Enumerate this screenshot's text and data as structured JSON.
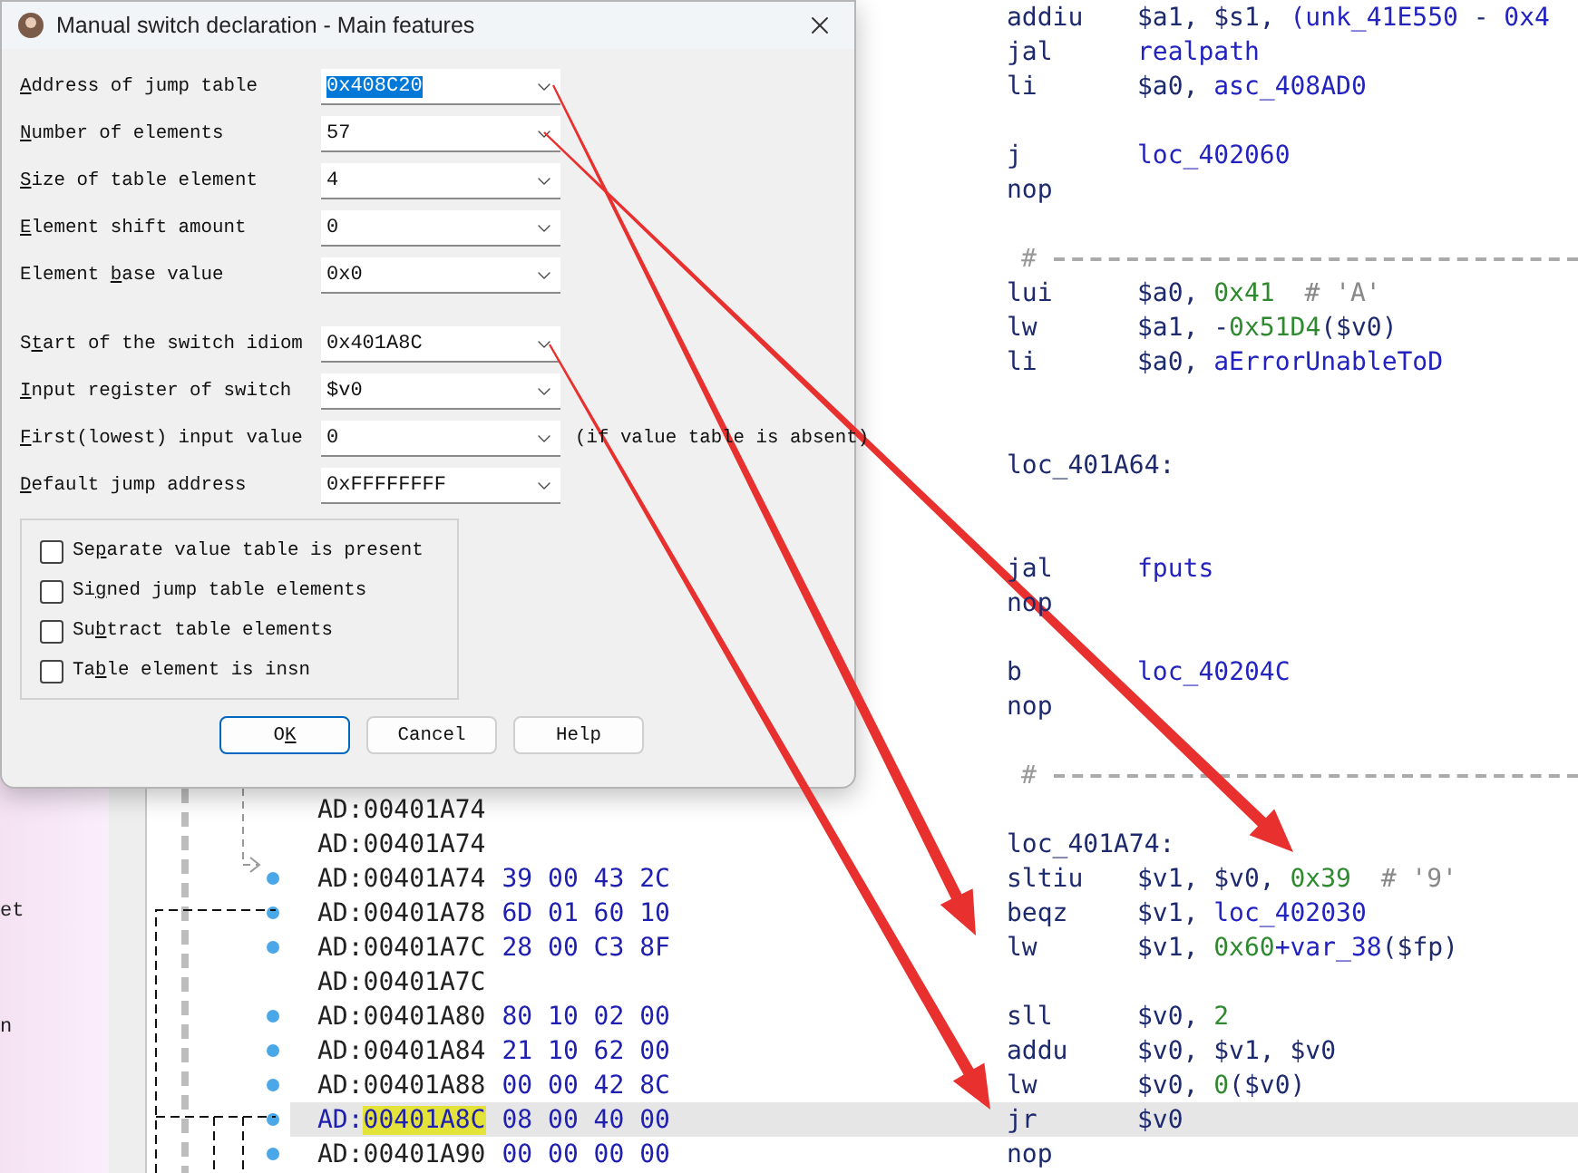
{
  "sidebar": {
    "fragments": [
      "et",
      "n"
    ]
  },
  "listing": {
    "rows": [
      {
        "kind": "insn",
        "highlighted": false,
        "mnemonic": "addiu",
        "operands": [
          [
            {
              "text": "$a1,",
              "kind": "reg"
            }
          ],
          [
            {
              "text": "$s1,",
              "kind": "reg"
            }
          ],
          [
            {
              "text": "(unk_41E550",
              "kind": "name"
            }
          ],
          [
            {
              "text": "-",
              "kind": "reg"
            }
          ],
          [
            {
              "text": "0x4",
              "kind": "name"
            }
          ]
        ]
      },
      {
        "kind": "insn",
        "highlighted": false,
        "mnemonic": "jal",
        "operands": [
          [
            {
              "text": "realpath",
              "kind": "name"
            }
          ]
        ]
      },
      {
        "kind": "insn",
        "highlighted": false,
        "mnemonic": "li",
        "operands": [
          [
            {
              "text": "$a0,",
              "kind": "reg"
            }
          ],
          [
            {
              "text": "asc_408AD0",
              "kind": "name"
            }
          ]
        ]
      },
      {
        "kind": "blank",
        "highlighted": false
      },
      {
        "kind": "insn",
        "highlighted": false,
        "mnemonic": "j",
        "operands": [
          [
            {
              "text": "loc_402060",
              "kind": "name"
            }
          ]
        ]
      },
      {
        "kind": "insn",
        "highlighted": false,
        "mnemonic": "nop"
      },
      {
        "kind": "blank",
        "highlighted": false
      },
      {
        "kind": "separator",
        "highlighted": false,
        "text": "#"
      },
      {
        "kind": "insn",
        "highlighted": false,
        "mnemonic": "lui",
        "operands": [
          [
            {
              "text": "$a0,",
              "kind": "reg"
            }
          ],
          [
            {
              "text": "0x41",
              "kind": "num"
            }
          ]
        ],
        "comment": "# 'A'"
      },
      {
        "kind": "insn",
        "highlighted": false,
        "mnemonic": "lw",
        "operands": [
          [
            {
              "text": "$a1,",
              "kind": "reg"
            }
          ],
          [
            {
              "text": "-",
              "kind": "reg"
            },
            {
              "text": "0x51D4",
              "kind": "num"
            },
            {
              "text": "($v0)",
              "kind": "reg"
            }
          ]
        ]
      },
      {
        "kind": "insn",
        "highlighted": false,
        "mnemonic": "li",
        "operands": [
          [
            {
              "text": "$a0,",
              "kind": "reg"
            }
          ],
          [
            {
              "text": "aErrorUnableToD",
              "kind": "name"
            }
          ]
        ]
      },
      {
        "kind": "blank",
        "highlighted": false
      },
      {
        "kind": "blank",
        "highlighted": false
      },
      {
        "kind": "label",
        "highlighted": false,
        "text": "loc_401A64:"
      },
      {
        "kind": "blank",
        "highlighted": false
      },
      {
        "kind": "blank",
        "highlighted": false
      },
      {
        "kind": "insn",
        "highlighted": false,
        "mnemonic": "jal",
        "operands": [
          [
            {
              "text": "fputs",
              "kind": "name"
            }
          ]
        ]
      },
      {
        "kind": "insn",
        "highlighted": false,
        "mnemonic": "nop"
      },
      {
        "kind": "blank",
        "highlighted": false
      },
      {
        "kind": "insn",
        "highlighted": false,
        "mnemonic": "b",
        "operands": [
          [
            {
              "text": "loc_40204C",
              "kind": "name"
            }
          ]
        ]
      },
      {
        "kind": "insn",
        "highlighted": false,
        "mnemonic": "nop"
      },
      {
        "kind": "blank",
        "highlighted": false
      },
      {
        "kind": "separator",
        "highlighted": false,
        "text": "#"
      },
      {
        "kind": "blank",
        "highlighted": false,
        "segment": "AD:",
        "address": "00401A74"
      },
      {
        "kind": "label",
        "highlighted": false,
        "segment": "AD:",
        "address": "00401A74",
        "text": "loc_401A74:"
      },
      {
        "kind": "insn",
        "highlighted": false,
        "segment": "AD:",
        "address": "00401A74",
        "bytes": "39 00 43 2C",
        "mnemonic": "sltiu",
        "operands": [
          [
            {
              "text": "$v1,",
              "kind": "reg"
            }
          ],
          [
            {
              "text": "$v0,",
              "kind": "reg"
            }
          ],
          [
            {
              "text": "0x39",
              "kind": "num"
            }
          ]
        ],
        "comment": "# '9'"
      },
      {
        "kind": "insn",
        "highlighted": false,
        "segment": "AD:",
        "address": "00401A78",
        "bytes": "6D 01 60 10",
        "mnemonic": "beqz",
        "operands": [
          [
            {
              "text": "$v1,",
              "kind": "reg"
            }
          ],
          [
            {
              "text": "loc_402030",
              "kind": "name"
            }
          ]
        ]
      },
      {
        "kind": "insn",
        "highlighted": false,
        "segment": "AD:",
        "address": "00401A7C",
        "bytes": "28 00 C3 8F",
        "mnemonic": "lw",
        "operands": [
          [
            {
              "text": "$v1,",
              "kind": "reg"
            }
          ],
          [
            {
              "text": "0x60",
              "kind": "num"
            },
            {
              "text": "+var_38",
              "kind": "name"
            },
            {
              "text": "($fp)",
              "kind": "reg"
            }
          ]
        ]
      },
      {
        "kind": "blank",
        "highlighted": false,
        "segment": "AD:",
        "address": "00401A7C"
      },
      {
        "kind": "insn",
        "highlighted": false,
        "segment": "AD:",
        "address": "00401A80",
        "bytes": "80 10 02 00",
        "mnemonic": "sll",
        "operands": [
          [
            {
              "text": "$v0,",
              "kind": "reg"
            }
          ],
          [
            {
              "text": "2",
              "kind": "num"
            }
          ]
        ]
      },
      {
        "kind": "insn",
        "highlighted": false,
        "segment": "AD:",
        "address": "00401A84",
        "bytes": "21 10 62 00",
        "mnemonic": "addu",
        "operands": [
          [
            {
              "text": "$v0,",
              "kind": "reg"
            }
          ],
          [
            {
              "text": "$v1,",
              "kind": "reg"
            }
          ],
          [
            {
              "text": "$v0",
              "kind": "reg"
            }
          ]
        ]
      },
      {
        "kind": "insn",
        "highlighted": false,
        "segment": "AD:",
        "address": "00401A88",
        "bytes": "00 00 42 8C",
        "mnemonic": "lw",
        "operands": [
          [
            {
              "text": "$v0,",
              "kind": "reg"
            }
          ],
          [
            {
              "text": "0",
              "kind": "num"
            },
            {
              "text": "($v0)",
              "kind": "reg"
            }
          ]
        ]
      },
      {
        "kind": "insn",
        "highlighted": true,
        "segment": "AD:",
        "address": "00401A8C",
        "bytes": "08 00 40 00",
        "mnemonic": "jr",
        "operands": [
          [
            {
              "text": "$v0",
              "kind": "reg"
            }
          ]
        ]
      },
      {
        "kind": "insn",
        "highlighted": false,
        "segment": "AD:",
        "address": "00401A90",
        "bytes": "00 00 00 00",
        "mnemonic": "nop"
      }
    ]
  },
  "dialog": {
    "title": "Manual switch declaration - Main features",
    "field_groups": [
      [
        {
          "label": {
            "key": "A",
            "post": "ddress of jump table"
          },
          "value": "0x408C20",
          "selected": true
        },
        {
          "label": {
            "key": "N",
            "post": "umber of elements"
          },
          "value": "57",
          "selected": false
        },
        {
          "label": {
            "key": "S",
            "post": "ize of table element"
          },
          "value": "4",
          "selected": false
        },
        {
          "label": {
            "key": "E",
            "post": "lement shift amount"
          },
          "value": "0",
          "selected": false
        },
        {
          "label": {
            "pre": "Element ",
            "key": "b",
            "post": "ase value"
          },
          "value": "0x0",
          "selected": false
        }
      ],
      [
        {
          "label": {
            "pre": "S",
            "key": "t",
            "post": "art of the switch idiom"
          },
          "value": "0x401A8C",
          "selected": false
        },
        {
          "label": {
            "key": "I",
            "post": "nput register of switch"
          },
          "value": "$v0",
          "selected": false
        },
        {
          "label": {
            "key": "F",
            "post": "irst(lowest) input value"
          },
          "value": "0",
          "selected": false,
          "hint": "(if value table is absent)"
        },
        {
          "label": {
            "key": "D",
            "post": "efault jump address"
          },
          "value": "0xFFFFFFFF",
          "selected": false
        }
      ]
    ],
    "options": [
      {
        "label": {
          "pre": "Se",
          "key": "p",
          "post": "arate value table is present"
        },
        "checked": false
      },
      {
        "label": {
          "pre": "Si",
          "key": "g",
          "post": "ned jump table elements"
        },
        "checked": false
      },
      {
        "label": {
          "pre": "Su",
          "key": "b",
          "post": "tract table elements"
        },
        "checked": false
      },
      {
        "label": {
          "pre": "Ta",
          "key": "b",
          "post": "le element is insn"
        },
        "checked": false
      }
    ],
    "buttons": [
      {
        "label": {
          "pre": "O",
          "key": "K"
        },
        "default": true
      },
      {
        "label": {
          "pre": "Cancel"
        },
        "default": false
      },
      {
        "label": {
          "pre": "Help"
        },
        "default": false
      }
    ]
  }
}
